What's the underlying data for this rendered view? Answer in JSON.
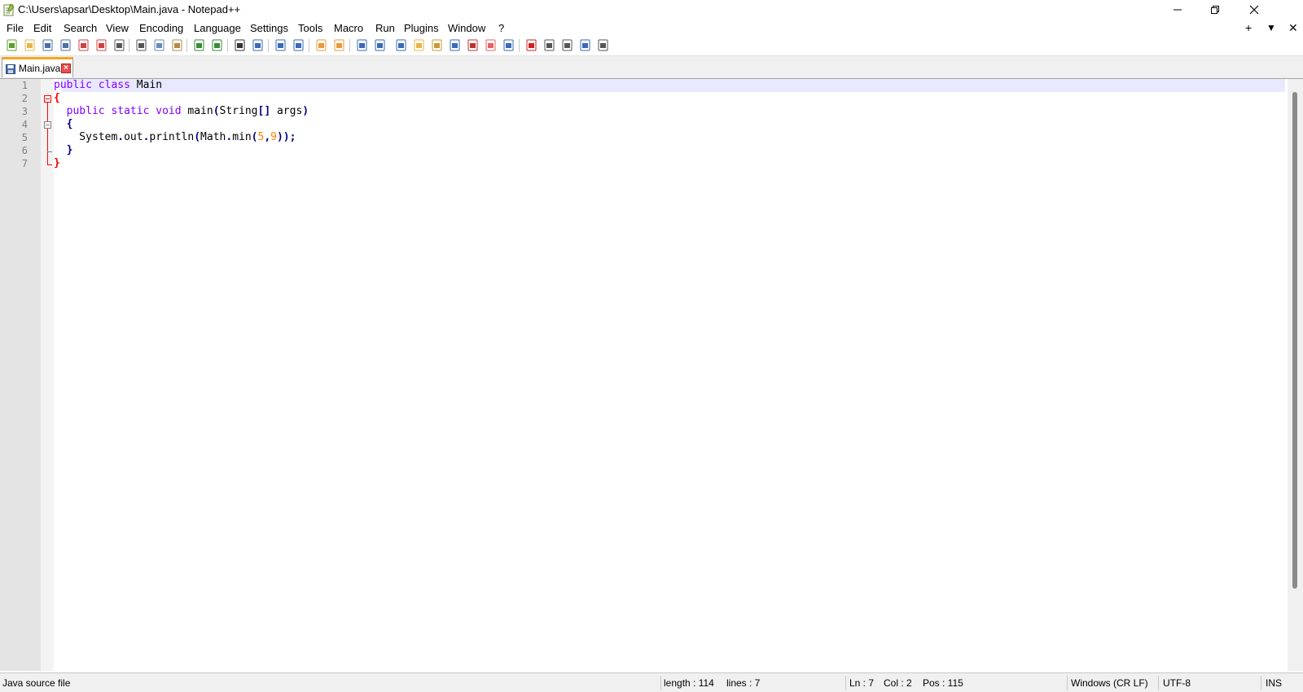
{
  "window": {
    "title": "C:\\Users\\apsar\\Desktop\\Main.java - Notepad++",
    "minimize": "—",
    "restore": "❐",
    "close": "✕"
  },
  "menu": {
    "items": [
      "File",
      "Edit",
      "Search",
      "View",
      "Encoding",
      "Language",
      "Settings",
      "Tools",
      "Macro",
      "Run",
      "Plugins",
      "Window",
      "?"
    ],
    "right": [
      "+",
      "▼",
      "✕"
    ]
  },
  "toolbar": {
    "buttons": [
      {
        "name": "new-file-icon",
        "color": "#5aa02c"
      },
      {
        "name": "open-file-icon",
        "color": "#e8b44a"
      },
      {
        "name": "save-icon",
        "color": "#4a6fa5"
      },
      {
        "name": "save-all-icon",
        "color": "#4a6fa5"
      },
      {
        "name": "close-icon",
        "color": "#d04040"
      },
      {
        "name": "close-all-icon",
        "color": "#d04040"
      },
      {
        "name": "print-icon",
        "color": "#555555"
      },
      {
        "name": "cut-icon",
        "color": "#555555"
      },
      {
        "name": "copy-icon",
        "color": "#6a8ab5"
      },
      {
        "name": "paste-icon",
        "color": "#b58a4a"
      },
      {
        "name": "undo-icon",
        "color": "#3a8a3a"
      },
      {
        "name": "redo-icon",
        "color": "#3a8a3a"
      },
      {
        "name": "find-icon",
        "color": "#333333"
      },
      {
        "name": "replace-icon",
        "color": "#3a6ab5"
      },
      {
        "name": "zoom-in-icon",
        "color": "#3a6ab5"
      },
      {
        "name": "zoom-out-icon",
        "color": "#3a6ab5"
      },
      {
        "name": "sync-vertical-icon",
        "color": "#e89a3a"
      },
      {
        "name": "sync-horizontal-icon",
        "color": "#e89a3a"
      },
      {
        "name": "word-wrap-icon",
        "color": "#3a6ab5"
      },
      {
        "name": "show-all-chars-icon",
        "color": "#3a6ab5"
      },
      {
        "name": "indent-guide-icon",
        "color": "#3a6ab5"
      },
      {
        "name": "udl-icon",
        "color": "#e8b44a"
      },
      {
        "name": "doc-map-icon",
        "color": "#c89a3a"
      },
      {
        "name": "function-list-icon",
        "color": "#3a6ab5"
      },
      {
        "name": "folder-workspace-icon",
        "color": "#c03030"
      },
      {
        "name": "monitoring-icon",
        "color": "#e86060"
      },
      {
        "name": "preview-icon",
        "color": "#3a6ab5"
      },
      {
        "name": "record-macro-icon",
        "color": "#d02020"
      },
      {
        "name": "stop-recording-icon",
        "color": "#555555"
      },
      {
        "name": "playback-macro-icon",
        "color": "#555555"
      },
      {
        "name": "run-macro-multiple-icon",
        "color": "#3a6ab5"
      },
      {
        "name": "save-macro-icon",
        "color": "#555555"
      }
    ]
  },
  "tabs": [
    {
      "label": "Main.java",
      "active": true
    }
  ],
  "editor": {
    "line_numbers": [
      "1",
      "2",
      "3",
      "4",
      "5",
      "6",
      "7"
    ],
    "lines": [
      [
        {
          "t": "public",
          "c": "kw"
        },
        {
          "t": " "
        },
        {
          "t": "class",
          "c": "kw"
        },
        {
          "t": " Main"
        }
      ],
      [
        {
          "t": "{",
          "c": "brace-red"
        }
      ],
      [
        {
          "t": "  "
        },
        {
          "t": "public",
          "c": "kw"
        },
        {
          "t": " "
        },
        {
          "t": "static",
          "c": "kw"
        },
        {
          "t": " "
        },
        {
          "t": "void",
          "c": "kw"
        },
        {
          "t": " main"
        },
        {
          "t": "(",
          "c": "op"
        },
        {
          "t": "String"
        },
        {
          "t": "[]",
          "c": "op"
        },
        {
          "t": " args"
        },
        {
          "t": ")",
          "c": "op"
        }
      ],
      [
        {
          "t": "  "
        },
        {
          "t": "{",
          "c": "op"
        }
      ],
      [
        {
          "t": "    System"
        },
        {
          "t": ".",
          "c": "op"
        },
        {
          "t": "out"
        },
        {
          "t": ".",
          "c": "op"
        },
        {
          "t": "println"
        },
        {
          "t": "(",
          "c": "op"
        },
        {
          "t": "Math"
        },
        {
          "t": ".",
          "c": "op"
        },
        {
          "t": "min"
        },
        {
          "t": "(",
          "c": "op"
        },
        {
          "t": "5",
          "c": "num"
        },
        {
          "t": ",",
          "c": "op"
        },
        {
          "t": "9",
          "c": "num"
        },
        {
          "t": "));",
          "c": "op"
        }
      ],
      [
        {
          "t": "  "
        },
        {
          "t": "}",
          "c": "op"
        }
      ],
      [
        {
          "t": "}",
          "c": "brace-red"
        }
      ]
    ]
  },
  "status": {
    "file_type": "Java source file",
    "length": "length : 114",
    "lines": "lines : 7",
    "ln": "Ln : 7",
    "col": "Col : 2",
    "pos": "Pos : 115",
    "eol": "Windows (CR LF)",
    "encoding": "UTF-8",
    "mode": "INS"
  }
}
